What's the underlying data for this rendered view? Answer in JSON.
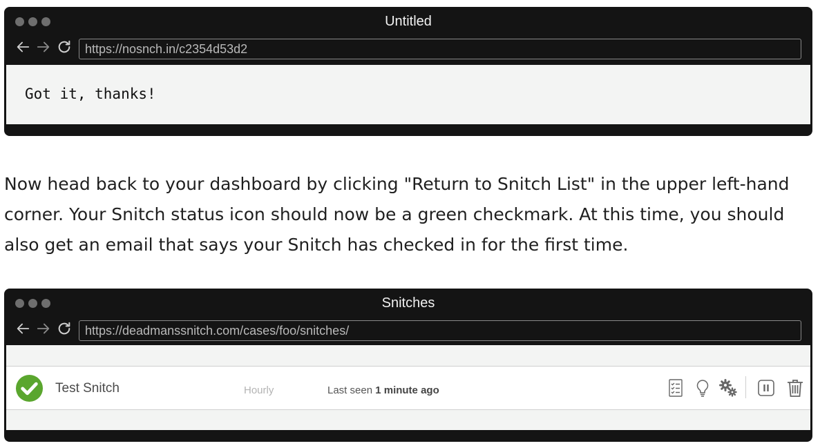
{
  "top_window": {
    "title": "Untitled",
    "url": "https://nosnch.in/c2354d53d2",
    "body_text": "Got it, thanks!"
  },
  "article": {
    "paragraph": "Now head back to your dashboard by clicking \"Return to Snitch List\" in the upper left-hand corner. Your Snitch status icon should now be a green checkmark. At this time, you should also get an email that says your Snitch has checked in for the first time."
  },
  "bottom_window": {
    "title": "Snitches",
    "url": "https://deadmanssnitch.com/cases/foo/snitches/",
    "snitch": {
      "name": "Test Snitch",
      "interval": "Hourly",
      "last_seen_prefix": "Last seen",
      "last_seen_value": "1 minute ago",
      "status": "healthy",
      "status_color": "#5aa62e"
    },
    "action_icons": [
      "log-icon",
      "tips-lightbulb-icon",
      "settings-gears-icon",
      "pause-icon",
      "trash-icon"
    ]
  },
  "colors": {
    "window_chrome": "#141414",
    "viewport_bg": "#f3f4f3",
    "status_green": "#5aa62e"
  }
}
